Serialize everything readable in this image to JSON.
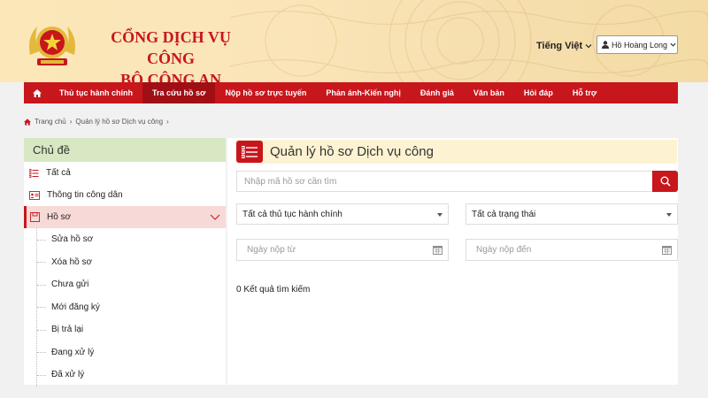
{
  "header": {
    "title_line1": "CỔNG DỊCH VỤ CÔNG",
    "title_line2": "BỘ CÔNG AN",
    "language": "Tiếng Việt",
    "user_name": "Hồ Hoàng Long"
  },
  "nav": {
    "items": [
      {
        "label": "Thủ tục hành chính"
      },
      {
        "label": "Tra cứu hồ sơ"
      },
      {
        "label": "Nộp hồ sơ trực tuyến"
      },
      {
        "label": "Phản ánh-Kiến nghị"
      },
      {
        "label": "Đánh giá"
      },
      {
        "label": "Văn bản"
      },
      {
        "label": "Hỏi đáp"
      },
      {
        "label": "Hỗ trợ"
      }
    ]
  },
  "breadcrumb": {
    "home": "Trang chủ",
    "current": "Quản lý hồ sơ Dịch vụ công"
  },
  "sidebar": {
    "heading": "Chủ đề",
    "items": [
      {
        "label": "Tất cả"
      },
      {
        "label": "Thông tin công dân"
      },
      {
        "label": "Hồ sơ"
      }
    ],
    "sub_items": [
      {
        "label": "Sửa hồ sơ"
      },
      {
        "label": "Xóa hồ sơ"
      },
      {
        "label": "Chưa gửi"
      },
      {
        "label": "Mới đăng ký"
      },
      {
        "label": "Bị trả lại"
      },
      {
        "label": "Đang xử lý"
      },
      {
        "label": "Đã xử lý"
      }
    ]
  },
  "main": {
    "title": "Quản lý hồ sơ Dịch vụ công",
    "search_placeholder": "Nhập mã hồ sơ cần tìm",
    "procedure_select": "Tất cả thủ tục hành chính",
    "status_select": "Tất cả trạng thái",
    "date_from_placeholder": "Ngày nộp từ",
    "date_to_placeholder": "Ngày nộp đến",
    "result_text": "0 Kết quả tìm kiếm"
  },
  "colors": {
    "brand_red": "#c8161d",
    "header_bg": "#fae5b9",
    "sidebar_head_bg": "#d7e8c3",
    "active_item_bg": "#f7d9d7"
  }
}
